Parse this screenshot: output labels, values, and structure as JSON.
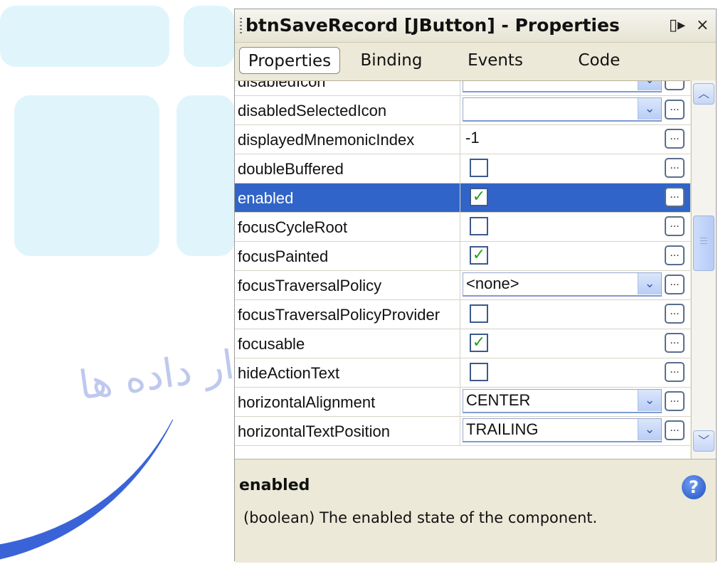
{
  "window": {
    "title": "btnSaveRecord [JButton] - Properties",
    "minimize_glyph": "▯▸",
    "close_glyph": "×"
  },
  "tabs": [
    {
      "label": "Properties",
      "active": true
    },
    {
      "label": "Binding",
      "active": false
    },
    {
      "label": "Events",
      "active": false
    },
    {
      "label": "Code",
      "active": false
    }
  ],
  "properties": [
    {
      "name": "disabledIcon",
      "type": "combo",
      "value": "",
      "partial": true
    },
    {
      "name": "disabledSelectedIcon",
      "type": "combo",
      "value": ""
    },
    {
      "name": "displayedMnemonicIndex",
      "type": "text",
      "value": "-1"
    },
    {
      "name": "doubleBuffered",
      "type": "check",
      "checked": false
    },
    {
      "name": "enabled",
      "type": "check",
      "checked": true,
      "selected": true
    },
    {
      "name": "focusCycleRoot",
      "type": "check",
      "checked": false
    },
    {
      "name": "focusPainted",
      "type": "check",
      "checked": true
    },
    {
      "name": "focusTraversalPolicy",
      "type": "combo",
      "value": "<none>"
    },
    {
      "name": "focusTraversalPolicyProvider",
      "type": "check",
      "checked": false
    },
    {
      "name": "focusable",
      "type": "check",
      "checked": true
    },
    {
      "name": "hideActionText",
      "type": "check",
      "checked": false
    },
    {
      "name": "horizontalAlignment",
      "type": "combo",
      "value": "CENTER"
    },
    {
      "name": "horizontalTextPosition",
      "type": "combo",
      "value": "TRAILING"
    }
  ],
  "ellipsis_label": "...",
  "check_glyph": "✓",
  "combo_arrow_glyph": "⌄",
  "description": {
    "title": "enabled",
    "text": "(boolean) The enabled state of the component.",
    "help_glyph": "?"
  },
  "scrollbar": {
    "up_glyph": "︿",
    "down_glyph": "﹀"
  },
  "watermark": {
    "text": "تکرار داده ها"
  },
  "colors": {
    "selection": "#3164c8",
    "panel_bg": "#ece9d8",
    "check_green": "#1fa31f"
  }
}
